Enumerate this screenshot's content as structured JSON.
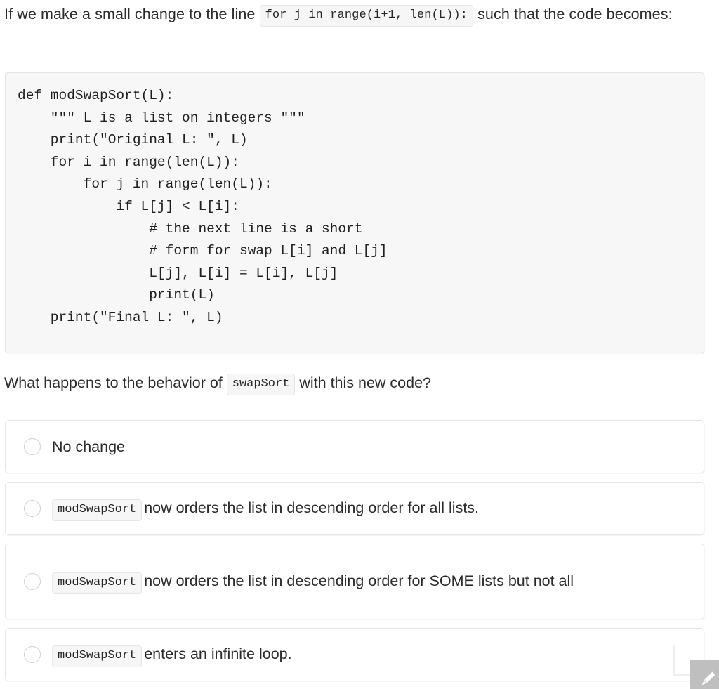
{
  "intro": {
    "before": "If we make a small change to the line",
    "code_chip": "for j in range(i+1, len(L)):",
    "after": "such that the code becomes:"
  },
  "code_block": {
    "language": "python",
    "content": "def modSwapSort(L):\n    \"\"\" L is a list on integers \"\"\"\n    print(\"Original L: \", L)\n    for i in range(len(L)):\n        for j in range(len(L)):\n            if L[j] < L[i]:\n                # the next line is a short\n                # form for swap L[i] and L[j]\n                L[j], L[i] = L[i], L[j]\n                print(L)\n    print(\"Final L: \", L)"
  },
  "question": {
    "before": "What happens to the behavior of",
    "code_chip": "swapSort",
    "after": "with this new code?"
  },
  "options": [
    {
      "id": "option-no-change",
      "chip": "",
      "text": "No change",
      "selected": false
    },
    {
      "id": "option-descending-all",
      "chip": "modSwapSort",
      "text": "now orders the list in descending order for all lists.",
      "selected": false
    },
    {
      "id": "option-descending-some",
      "chip": "modSwapSort",
      "text": "now orders the list in descending order for SOME lists but not all",
      "selected": false
    },
    {
      "id": "option-infinite-loop",
      "chip": "modSwapSort",
      "text": "enters an infinite loop.",
      "selected": false
    }
  ],
  "colors": {
    "page_background": "#ffffff",
    "text": "#2b2b2b",
    "code_background": "#f7f7f7",
    "code_border": "#e4e4e4",
    "chip_background": "#f6f6f6",
    "chip_border": "#e6e6e6",
    "card_border": "#e6e6e6",
    "radio_border": "#d2d2d2",
    "handle_background": "#bfbfbf"
  }
}
